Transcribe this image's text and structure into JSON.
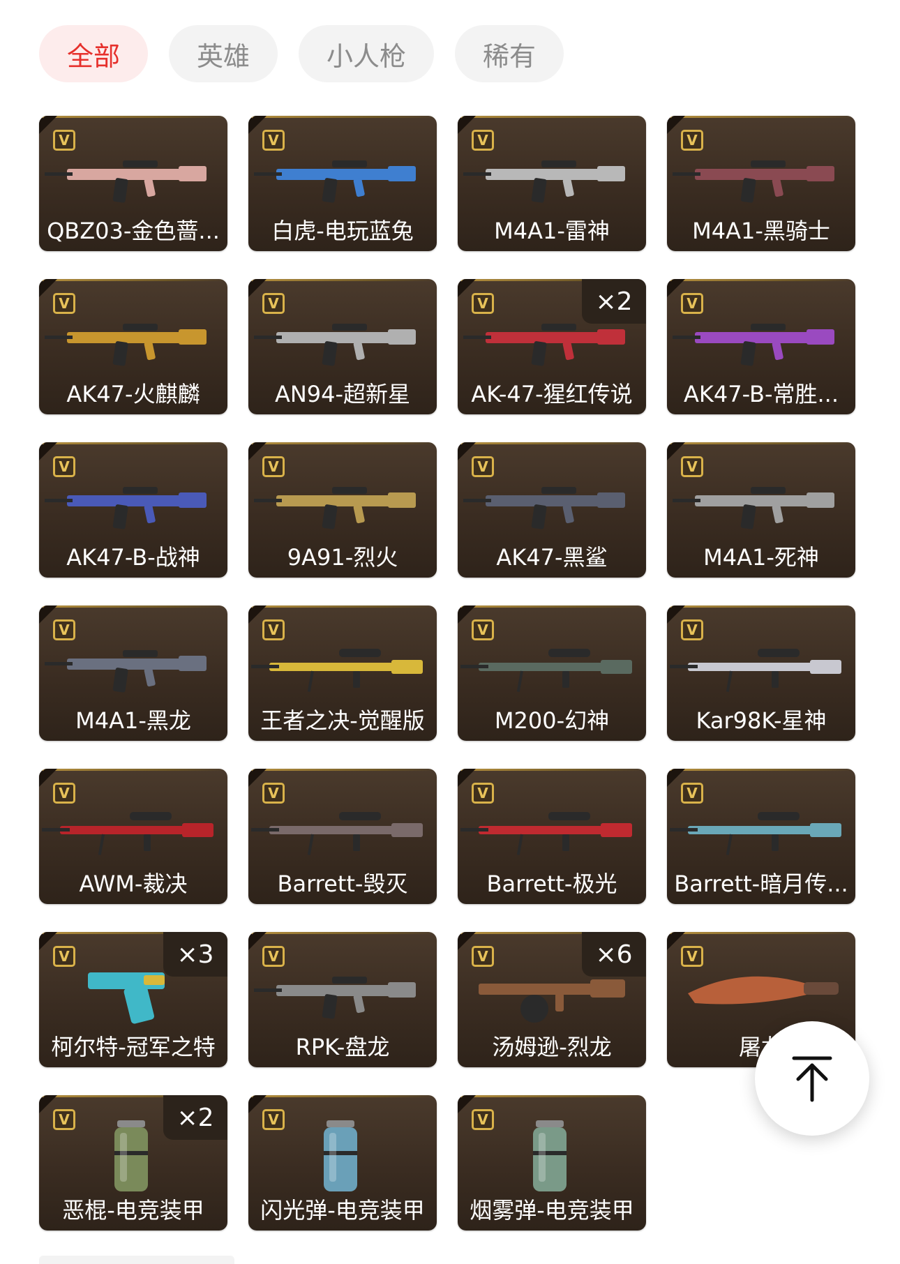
{
  "tabs": [
    {
      "label": "全部",
      "active": true
    },
    {
      "label": "英雄",
      "active": false
    },
    {
      "label": "小人枪",
      "active": false
    },
    {
      "label": "稀有",
      "active": false
    }
  ],
  "badge_glyph": "V",
  "items": [
    {
      "name": "QBZ03-金色蔷...",
      "count": null,
      "kind": "rifle",
      "color": "#d8a7a0"
    },
    {
      "name": "白虎-电玩蓝兔",
      "count": null,
      "kind": "rifle",
      "color": "#3f7fd0"
    },
    {
      "name": "M4A1-雷神",
      "count": null,
      "kind": "rifle",
      "color": "#b8b8b8"
    },
    {
      "name": "M4A1-黑骑士",
      "count": null,
      "kind": "rifle",
      "color": "#8a4a52"
    },
    {
      "name": "AK47-火麒麟",
      "count": null,
      "kind": "rifle",
      "color": "#c8962e"
    },
    {
      "name": "AN94-超新星",
      "count": null,
      "kind": "rifle",
      "color": "#b0b0b0"
    },
    {
      "name": "AK-47-猩红传说",
      "count": "×2",
      "kind": "rifle",
      "color": "#c0303a"
    },
    {
      "name": "AK47-B-常胜...",
      "count": null,
      "kind": "rifle",
      "color": "#9a4ac0"
    },
    {
      "name": "AK47-B-战神",
      "count": null,
      "kind": "rifle",
      "color": "#4a5ab8"
    },
    {
      "name": "9A91-烈火",
      "count": null,
      "kind": "rifle",
      "color": "#b89a50"
    },
    {
      "name": "AK47-黑鲨",
      "count": null,
      "kind": "rifle",
      "color": "#5a5f70"
    },
    {
      "name": "M4A1-死神",
      "count": null,
      "kind": "rifle",
      "color": "#a0a0a0"
    },
    {
      "name": "M4A1-黑龙",
      "count": null,
      "kind": "rifle",
      "color": "#6a7080"
    },
    {
      "name": "王者之决-觉醒版",
      "count": null,
      "kind": "sniper",
      "color": "#d8b83a"
    },
    {
      "name": "M200-幻神",
      "count": null,
      "kind": "sniper",
      "color": "#5a6a60"
    },
    {
      "name": "Kar98K-星神",
      "count": null,
      "kind": "sniper",
      "color": "#c8c8d0"
    },
    {
      "name": "AWM-裁决",
      "count": null,
      "kind": "sniper",
      "color": "#b8242a"
    },
    {
      "name": "Barrett-毁灭",
      "count": null,
      "kind": "sniper",
      "color": "#7a6a6a"
    },
    {
      "name": "Barrett-极光",
      "count": null,
      "kind": "sniper",
      "color": "#c02a30"
    },
    {
      "name": "Barrett-暗月传...",
      "count": null,
      "kind": "sniper",
      "color": "#6aa8b8"
    },
    {
      "name": "柯尔特-冠军之特",
      "count": "×3",
      "kind": "pistol",
      "color": "#40b8c8"
    },
    {
      "name": "RPK-盘龙",
      "count": null,
      "kind": "rifle",
      "color": "#8a8a8a"
    },
    {
      "name": "汤姆逊-烈龙",
      "count": "×6",
      "kind": "smg",
      "color": "#8a5a3a"
    },
    {
      "name": "屠龙",
      "count": null,
      "kind": "knife",
      "color": "#b8603a"
    },
    {
      "name": "恶棍-电竞装甲",
      "count": "×2",
      "kind": "grenade",
      "color": "#7a8a5a"
    },
    {
      "name": "闪光弹-电竞装甲",
      "count": null,
      "kind": "grenade",
      "color": "#6aa0b8"
    },
    {
      "name": "烟雾弹-电竞装甲",
      "count": null,
      "kind": "grenade",
      "color": "#7a9a88"
    }
  ],
  "back_to_top_icon": "arrow-up-bar-icon"
}
